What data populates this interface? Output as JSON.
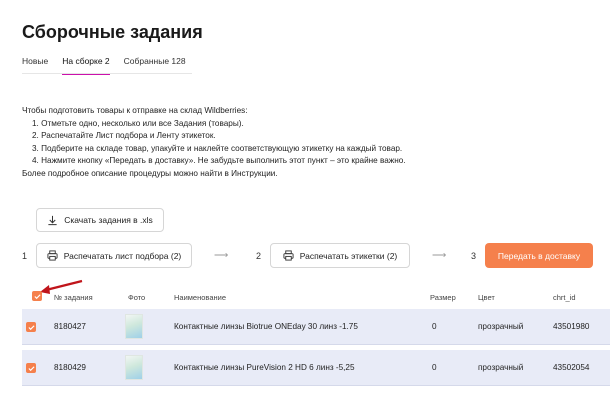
{
  "page_title": "Сборочные задания",
  "tabs": [
    {
      "label": "Новые"
    },
    {
      "label": "На сборке 2"
    },
    {
      "label": "Собранные 128"
    }
  ],
  "instructions": {
    "intro": "Чтобы подготовить товары к отправке на склад Wildberries:",
    "steps": [
      "1. Отметьте одно, несколько или все Задания (товары).",
      "2. Распечатайте Лист подбора и Ленту этикеток.",
      "3. Подберите на складе товар, упакуйте и наклейте соответствующую этикетку на каждый товар.",
      "4. Нажмите кнопку «Передать в доставку». Не забудьте выполнить этот пункт – это крайне важно."
    ],
    "outro": "Более подробное описание процедуры можно найти в Инструкции."
  },
  "actions": {
    "download_label": "Скачать задания в .xls",
    "step1": "1",
    "step2": "2",
    "step3": "3",
    "arrow": "⟶",
    "print_list_label": "Распечатать лист подбора (2)",
    "print_labels_label": "Распечатать этикетки (2)",
    "deliver_label": "Передать в доставку"
  },
  "table": {
    "columns": [
      "№ задания",
      "Фото",
      "Наименование",
      "Размер",
      "Цвет",
      "chrt_id"
    ],
    "rows": [
      {
        "id": "8180427",
        "name": "Контактные линзы Biotrue ONEday 30 линз -1.75",
        "size": "0",
        "color": "прозрачный",
        "chrt_id": "43501980",
        "checked": true
      },
      {
        "id": "8180429",
        "name": "Контактные линзы PureVision 2 HD 6 линз -5,25",
        "size": "0",
        "color": "прозрачный",
        "chrt_id": "43502054",
        "checked": true
      }
    ]
  },
  "colors": {
    "accent_orange": "#f5804c",
    "row_highlight": "#e8ebf7",
    "tab_underline": "#cb11ab",
    "annotation_arrow": "#c0151b"
  },
  "icons": {
    "download": "download-icon",
    "printer": "printer-icon",
    "checkbox": "checkmark-icon"
  }
}
